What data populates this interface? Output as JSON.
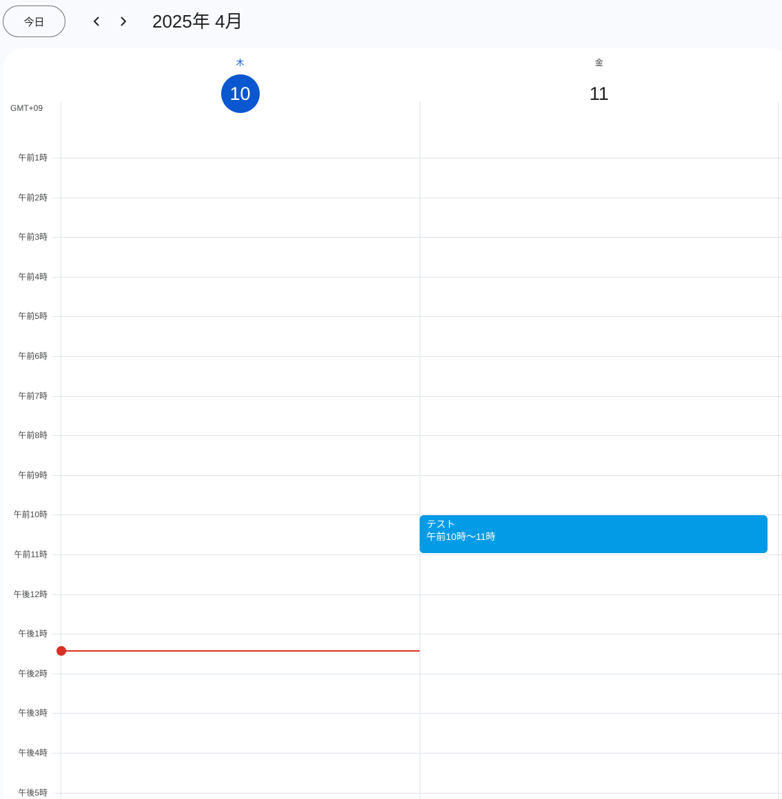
{
  "header": {
    "today_label": "今日",
    "month_title": "2025年 4月"
  },
  "days": [
    {
      "weekday": "木",
      "date": "10",
      "is_today": true
    },
    {
      "weekday": "金",
      "date": "11",
      "is_today": false
    }
  ],
  "timezone": "GMT+09",
  "hours": [
    "午前1時",
    "午前2時",
    "午前3時",
    "午前4時",
    "午前5時",
    "午前6時",
    "午前7時",
    "午前8時",
    "午前9時",
    "午前10時",
    "午前11時",
    "午後12時",
    "午後1時",
    "午後2時",
    "午後3時",
    "午後4時",
    "午後5時"
  ],
  "events": [
    {
      "title": "テスト",
      "time": "午前10時〜11時",
      "color": "#039be5"
    }
  ],
  "colors": {
    "accent": "#0b57d0",
    "now_indicator": "#d93025",
    "event": "#039be5",
    "gridline": "#dde3ea"
  }
}
